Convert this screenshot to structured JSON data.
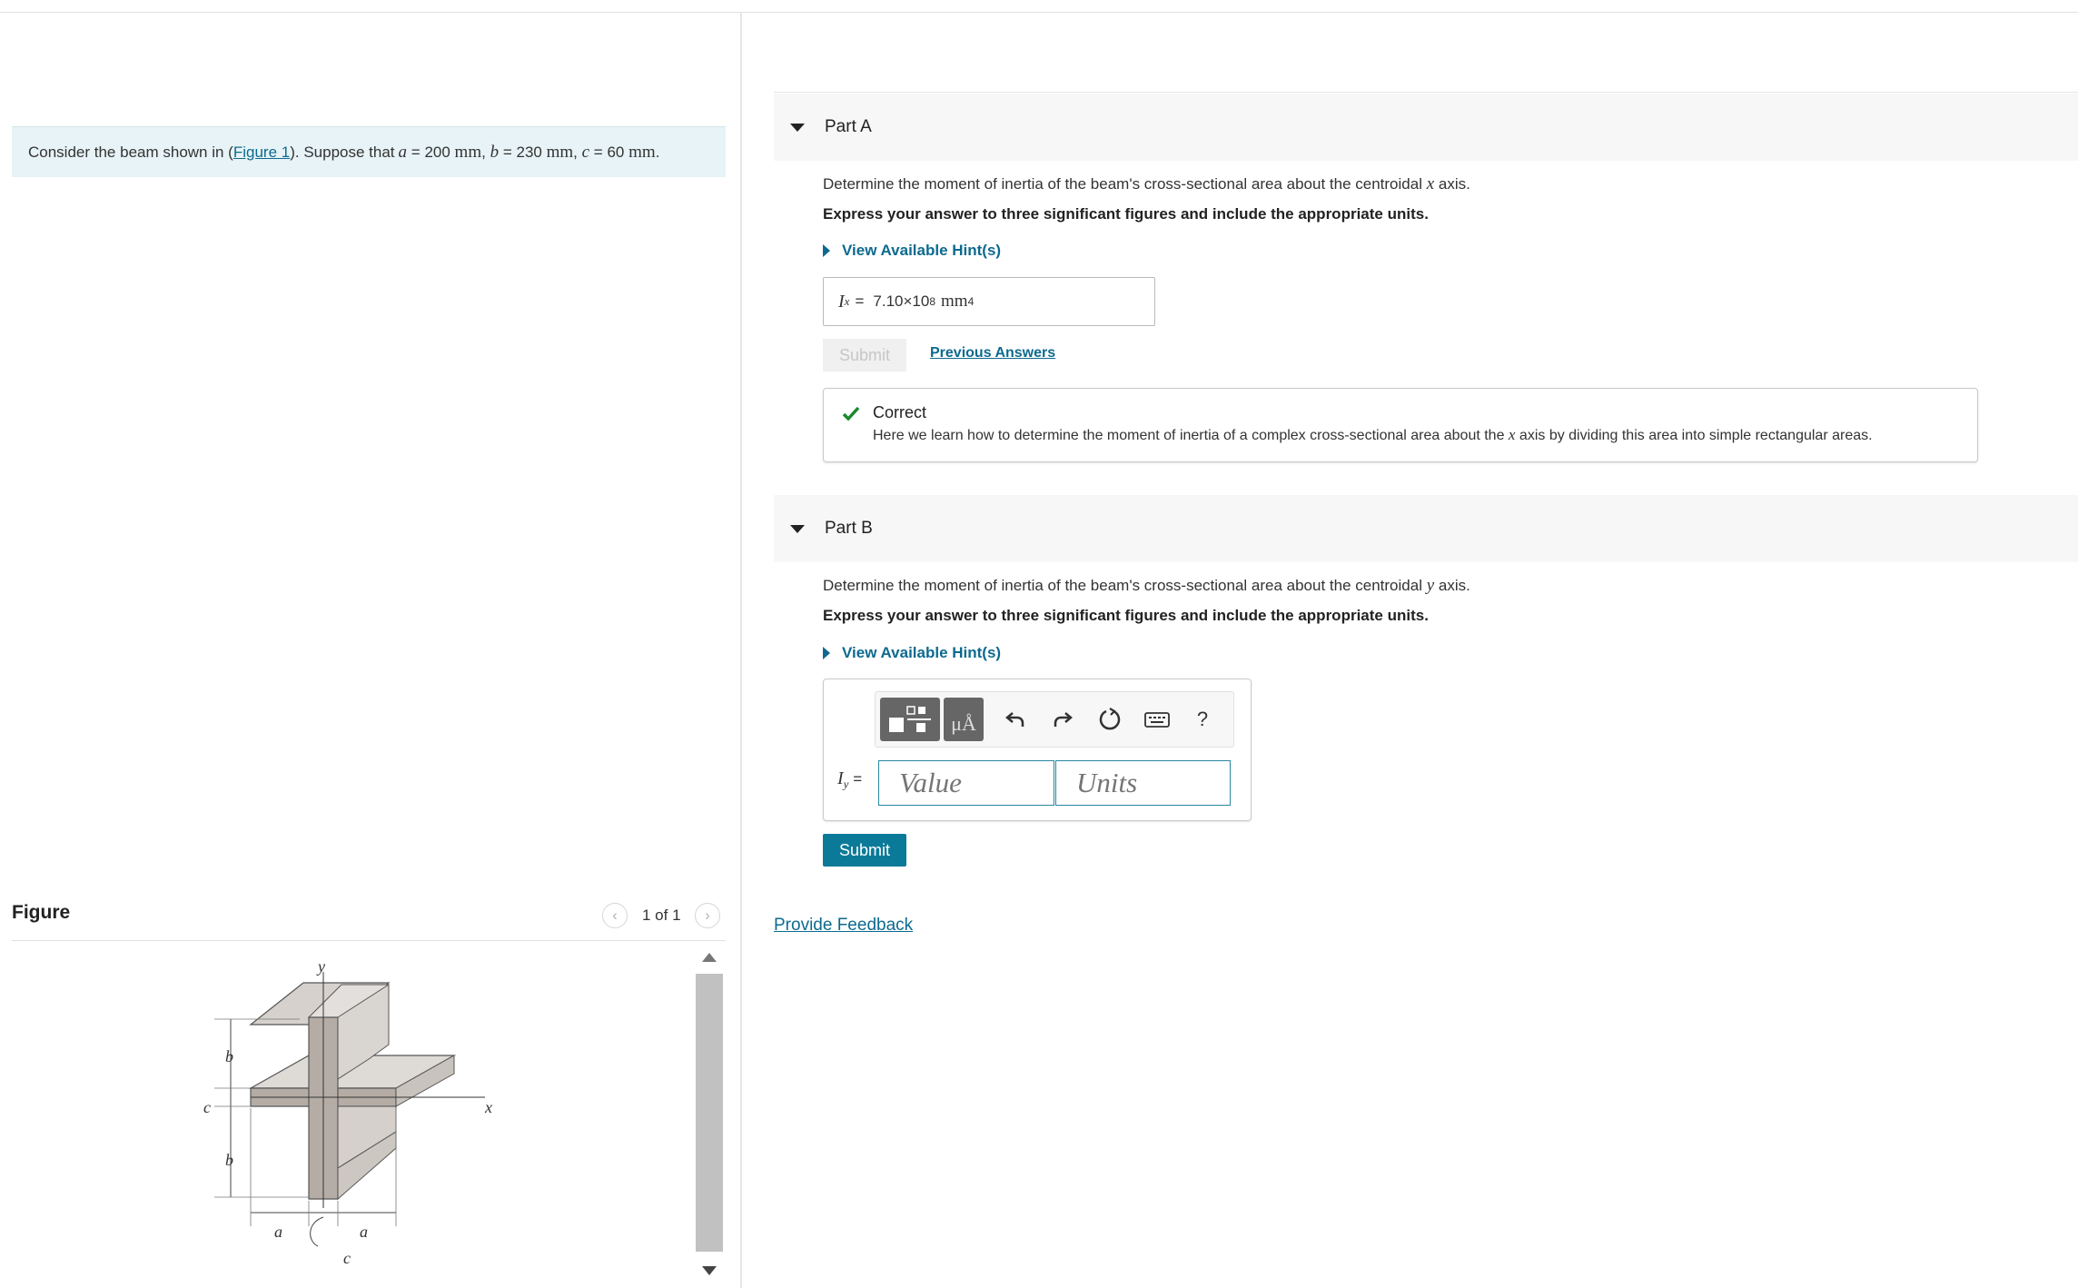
{
  "problem": {
    "prefix": "Consider the beam shown in (",
    "figure_link": "Figure 1",
    "mid": "). Suppose that ",
    "a_var": "a",
    "a_val": "200",
    "b_var": "b",
    "b_val": "230",
    "c_var": "c",
    "c_val": "60",
    "unit": "mm",
    "eq": "=",
    "sep": ",",
    "end": "."
  },
  "figure": {
    "title": "Figure",
    "counter": "1 of 1",
    "prev_icon": "chevron-left-icon",
    "next_icon": "chevron-right-icon",
    "labels": {
      "y": "y",
      "x": "x",
      "b": "b",
      "c": "c",
      "a": "a"
    }
  },
  "part_a": {
    "label": "Part A",
    "question_pre": "Determine the moment of inertia of the beam's cross-sectional area about the centroidal ",
    "axis": "x",
    "question_post": " axis.",
    "instruction": "Express your answer to three significant figures and include the appropriate units.",
    "hint": "View Available Hint(s)",
    "answer_symbol": "I",
    "answer_sub": "x",
    "answer_eq": "=",
    "answer_value": "7.10×10",
    "answer_exp": "8",
    "answer_unit": "mm",
    "answer_unit_exp": "4",
    "submit": "Submit",
    "previous": "Previous Answers",
    "feedback_title": "Correct",
    "feedback_pre": "Here we learn how to determine the moment of inertia of a complex cross-sectional area about the ",
    "feedback_axis": "x",
    "feedback_post": " axis by dividing this area into simple rectangular areas."
  },
  "part_b": {
    "label": "Part B",
    "question_pre": "Determine the moment of inertia of the beam's cross-sectional area about the centroidal ",
    "axis": "y",
    "question_post": " axis.",
    "instruction": "Express your answer to three significant figures and include the appropriate units.",
    "hint": "View Available Hint(s)",
    "answer_symbol": "I",
    "answer_sub": "y",
    "answer_eq": "=",
    "value_placeholder": "Value",
    "units_placeholder": "Units",
    "toolbar": {
      "templates_icon": "templates-icon",
      "units_icon": "units-icon",
      "units_label": "μÅ",
      "undo_icon": "undo-icon",
      "redo_icon": "redo-icon",
      "reset_icon": "reset-icon",
      "keyboard_icon": "keyboard-icon",
      "help": "?"
    },
    "submit": "Submit"
  },
  "footer": {
    "provide_feedback": "Provide Feedback"
  },
  "colors": {
    "link": "#0d6a8f",
    "submit_bg": "#0b7a98",
    "correct_check": "#1a8a2e",
    "problem_bg": "#e7f3f6"
  }
}
